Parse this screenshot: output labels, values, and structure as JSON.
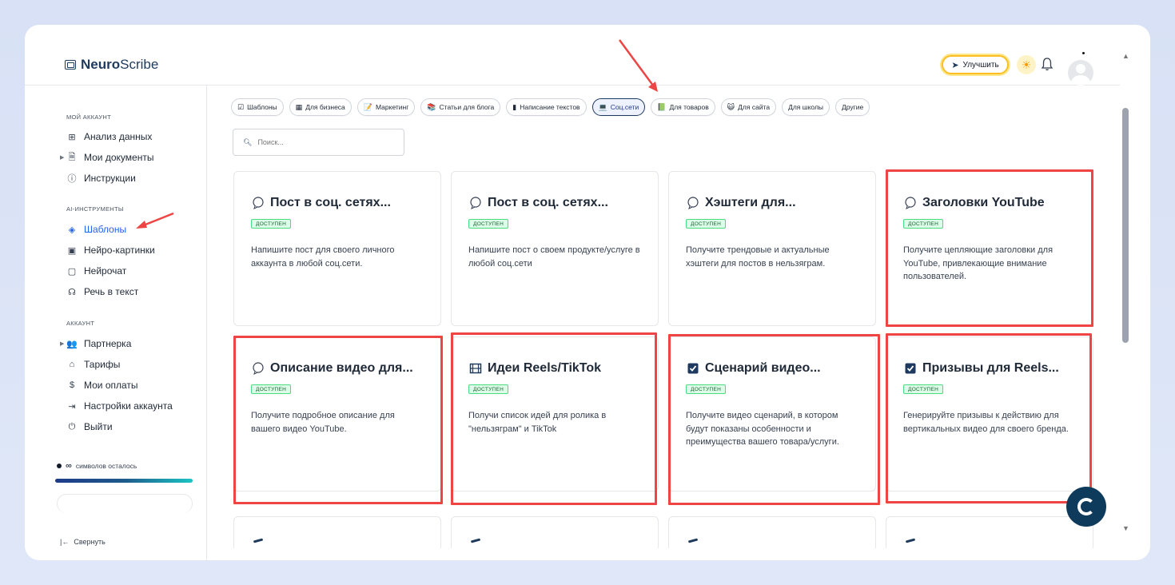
{
  "brand": {
    "name_bold": "Neuro",
    "name_regular": "Scribe"
  },
  "header": {
    "upgrade_label": "Улучшить"
  },
  "sidebar": {
    "section_my_account": "МОЙ АККАУНТ",
    "section_ai_tools": "AI-ИНСТРУМЕНТЫ",
    "section_account": "АККАУНТ",
    "items": [
      {
        "label": "Анализ данных",
        "icon": "grid-icon"
      },
      {
        "label": "Мои документы",
        "icon": "document-icon"
      },
      {
        "label": "Инструкции",
        "icon": "help-circle-icon"
      },
      {
        "label": "Шаблоны",
        "icon": "layers-icon",
        "active": true
      },
      {
        "label": "Нейро-картинки",
        "icon": "image-icon"
      },
      {
        "label": "Нейрочат",
        "icon": "chat-icon"
      },
      {
        "label": "Речь в текст",
        "icon": "headphones-icon"
      },
      {
        "label": "Партнерка",
        "icon": "users-icon"
      },
      {
        "label": "Тарифы",
        "icon": "tag-icon"
      },
      {
        "label": "Мои оплаты",
        "icon": "dollar-icon"
      },
      {
        "label": "Настройки аккаунта",
        "icon": "login-icon"
      },
      {
        "label": "Выйти",
        "icon": "power-icon"
      }
    ],
    "credits_symbol": "∞",
    "credits_text": "символов осталось",
    "collapse_label": "Свернуть"
  },
  "filters": [
    {
      "label": "Шаблоны",
      "icon": "☑"
    },
    {
      "label": "Для бизнеса",
      "icon": "▦"
    },
    {
      "label": "Маркетинг",
      "icon": "📝"
    },
    {
      "label": "Статьи для блога",
      "icon": "📚"
    },
    {
      "label": "Написание текстов",
      "icon": "▮"
    },
    {
      "label": "Соц.сети",
      "icon": "💻",
      "active": true
    },
    {
      "label": "Для товаров",
      "icon": "📗"
    },
    {
      "label": "Для сайта",
      "icon": "😺"
    },
    {
      "label": "Для школы",
      "icon": ""
    },
    {
      "label": "Другие",
      "icon": ""
    }
  ],
  "search": {
    "placeholder": "Поиск..."
  },
  "cards": [
    {
      "title": "Пост в соц. сетях...",
      "badge": "ДОСТУПЕН",
      "desc": "Напишите пост для своего личного аккаунта в любой соц.сети.",
      "icon": "speech-bubble-icon"
    },
    {
      "title": "Пост в соц. сетях...",
      "badge": "ДОСТУПЕН",
      "desc": "Напишите пост о своем продукте/услуге в любой соц.сети",
      "icon": "speech-bubble-icon"
    },
    {
      "title": "Хэштеги для...",
      "badge": "ДОСТУПЕН",
      "desc": "Получите трендовые и актуальные хэштеги для постов в нельзяграм.",
      "icon": "speech-bubble-icon"
    },
    {
      "title": "Заголовки YouTube",
      "badge": "ДОСТУПЕН",
      "desc": "Получите цепляющие заголовки для YouTube, привлекающие внимание пользователей.",
      "icon": "speech-bubble-icon"
    },
    {
      "title": "Описание видео для...",
      "badge": "ДОСТУПЕН",
      "desc": "Получите подробное описание для вашего видео YouTube.",
      "icon": "speech-bubble-icon"
    },
    {
      "title": "Идеи Reels/TikTok",
      "badge": "ДОСТУПЕН",
      "desc": "Получи список идей для ролика в \"нельзяграм\" и TikTok",
      "icon": "film-icon"
    },
    {
      "title": "Сценарий видео...",
      "badge": "ДОСТУПЕН",
      "desc": "Получите видео сценарий, в котором будут показаны особенности и преимущества вашего товара/услуги.",
      "icon": "checkbox-icon"
    },
    {
      "title": "Призывы для Reels...",
      "badge": "ДОСТУПЕН",
      "desc": "Генерируйте призывы к действию для вертикальных видео для своего бренда.",
      "icon": "checkbox-icon"
    }
  ],
  "colors": {
    "accent": "#2563eb",
    "brand_dark": "#1e3a5f",
    "highlight": "#ef4444",
    "badge_bg": "#dcfce7"
  }
}
